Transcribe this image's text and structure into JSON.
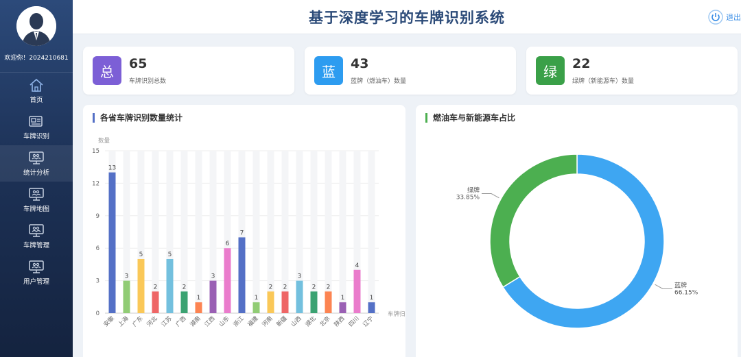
{
  "user": {
    "welcome": "欢迎你！2024210681"
  },
  "nav": [
    {
      "label": "首页",
      "icon": "home-icon"
    },
    {
      "label": "车牌识别",
      "icon": "license-plate-icon"
    },
    {
      "label": "统计分析",
      "icon": "monitor-icon"
    },
    {
      "label": "车牌地图",
      "icon": "monitor-icon"
    },
    {
      "label": "车牌管理",
      "icon": "monitor-icon"
    },
    {
      "label": "用户管理",
      "icon": "monitor-icon"
    }
  ],
  "header": {
    "title": "基于深度学习的车牌识别系统",
    "logout_label": "退出"
  },
  "stats": [
    {
      "badge": "总",
      "value": "65",
      "label": "车牌识别总数",
      "color": "#7c5fd6"
    },
    {
      "badge": "蓝",
      "value": "43",
      "label": "蓝牌（燃油车）数量",
      "color": "#2d9cf0"
    },
    {
      "badge": "绿",
      "value": "22",
      "label": "绿牌（新能源车）数量",
      "color": "#3aa048"
    }
  ],
  "bar_panel": {
    "title": "各省车牌识别数量统计"
  },
  "pie_panel": {
    "title": "燃油车与新能源车占比"
  },
  "chart_data": [
    {
      "type": "bar",
      "title": "各省车牌识别数量统计",
      "ylabel": "数量",
      "xlabel": "车牌归",
      "ylim": [
        0,
        15
      ],
      "yticks": [
        0,
        3,
        6,
        9,
        12,
        15
      ],
      "grid": true,
      "categories": [
        "安徽",
        "上海",
        "广东",
        "河北",
        "江苏",
        "广西",
        "湖南",
        "江西",
        "山东",
        "浙江",
        "福建",
        "河南",
        "新疆",
        "山西",
        "湖北",
        "北京",
        "陕西",
        "四川",
        "辽宁"
      ],
      "values": [
        13,
        3,
        5,
        2,
        5,
        2,
        1,
        3,
        6,
        7,
        1,
        2,
        2,
        3,
        2,
        2,
        1,
        4,
        1
      ],
      "colors": [
        "#5470c6",
        "#91cc75",
        "#fac858",
        "#ee6666",
        "#73c0de",
        "#3ba272",
        "#fc8452",
        "#9a60b4",
        "#ea7ccc",
        "#5470c6",
        "#91cc75",
        "#fac858",
        "#ee6666",
        "#73c0de",
        "#3ba272",
        "#fc8452",
        "#9a60b4",
        "#ea7ccc",
        "#5470c6"
      ]
    },
    {
      "type": "pie",
      "title": "燃油车与新能源车占比",
      "slices": [
        {
          "name": "蓝牌",
          "value": 43,
          "percent": "66.15%",
          "color": "#3ea6f2"
        },
        {
          "name": "绿牌",
          "value": 22,
          "percent": "33.85%",
          "color": "#4caf50"
        }
      ]
    }
  ]
}
